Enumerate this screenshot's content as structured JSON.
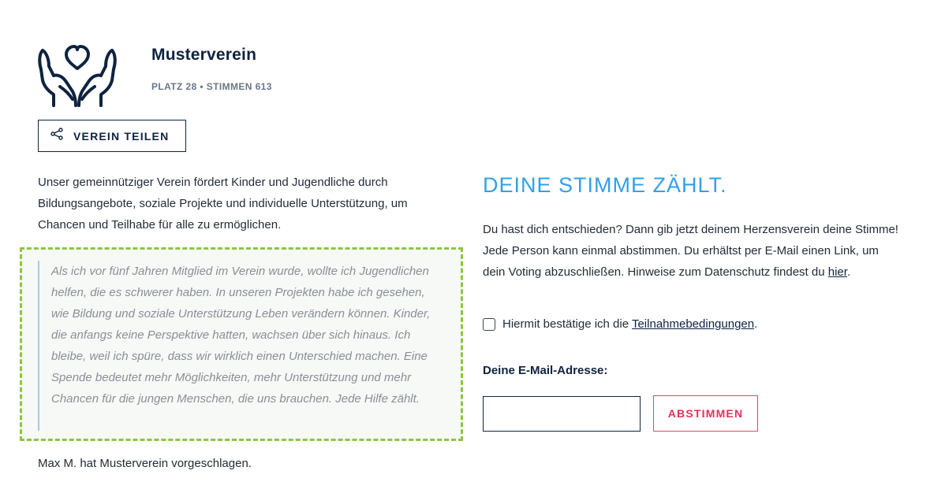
{
  "org": {
    "name": "Musterverein",
    "rank_label": "PLATZ 28",
    "separator": "•",
    "votes_label": "STIMMEN 613",
    "logo_icon": "hands-heart-icon"
  },
  "share": {
    "label": "VEREIN TEILEN",
    "icon": "share-icon"
  },
  "description": "Unser gemeinnütziger Verein fördert Kinder und Jugendliche durch Bildungsangebote, soziale Projekte und individuelle Unterstützung, um Chancen und Teilhabe für alle zu ermöglichen.",
  "quote": "Als ich vor fünf Jahren Mitglied im Verein wurde, wollte ich Jugendlichen helfen, die es schwerer haben. In unseren Projekten habe ich gesehen, wie Bildung und soziale Unterstützung Leben verändern können. Kinder, die anfangs keine Perspektive hatten, wachsen über sich hinaus. Ich bleibe, weil ich spüre, dass wir wirklich einen Unterschied machen. Eine Spende bedeutet mehr Möglichkeiten, mehr Unterstützung und mehr Chancen für die jungen Menschen, die uns brauchen. Jede Hilfe zählt.",
  "proposer": "Max M. hat Musterverein vorgeschlagen.",
  "vote": {
    "heading": "DEINE STIMME ZÄHLT.",
    "text_before_link": "Du hast dich entschieden? Dann gib jetzt deinem Herzensverein deine Stimme! Jede Person kann einmal abstimmen. Du erhältst per E-Mail einen Link, um dein Voting abzuschließen. Hinweise zum Datenschutz findest du ",
    "privacy_link": "hier",
    "text_after_link": ".",
    "consent_before": "Hiermit bestätige ich die ",
    "consent_link": "Teilnahmebedingungen",
    "consent_after": ".",
    "email_label": "Deine E-Mail-Adresse:",
    "email_value": "",
    "email_placeholder": "",
    "button_label": "ABSTIMMEN"
  },
  "colors": {
    "navy": "#0e2340",
    "accent_blue": "#33a0e8",
    "quote_border_green": "#8cc63f",
    "button_red": "#e0325c"
  }
}
